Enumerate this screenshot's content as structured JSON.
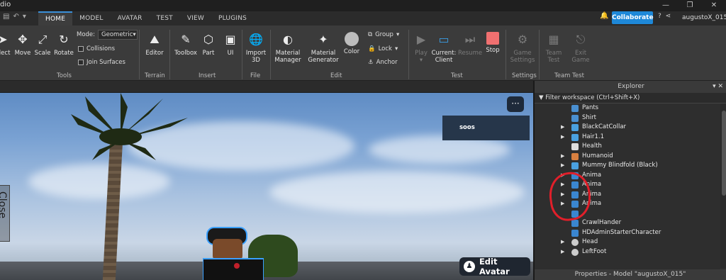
{
  "window": {
    "title": "dio",
    "controls": [
      "—",
      "❐",
      "✕"
    ]
  },
  "tabs": [
    "HOME",
    "MODEL",
    "AVATAR",
    "TEST",
    "VIEW",
    "PLUGINS"
  ],
  "topbar": {
    "collaborate_label": "Collaborate",
    "username": "augustoX_015"
  },
  "ribbon": {
    "tools": {
      "select": "elect",
      "move": "Move",
      "scale": "Scale",
      "rotate": "Rotate",
      "mode_label": "Mode:",
      "mode_value": "Geometric",
      "collisions": "Collisions",
      "join_surfaces": "Join Surfaces",
      "group_label": "Tools"
    },
    "terrain": {
      "editor": "Editor",
      "group_label": "Terrain"
    },
    "insert": {
      "toolbox": "Toolbox",
      "part": "Part",
      "ui": "UI",
      "group_label": "Insert"
    },
    "file": {
      "import_line1": "Import",
      "import_line2": "3D",
      "group_label": "File"
    },
    "edit": {
      "material_manager_1": "Material",
      "material_manager_2": "Manager",
      "material_generator_1": "Material",
      "material_generator_2": "Generator",
      "color": "Color",
      "group": "Group",
      "lock": "Lock",
      "anchor": "Anchor",
      "group_label": "Edit"
    },
    "test": {
      "play": "Play",
      "current_1": "Current:",
      "current_2": "Client",
      "resume": "Resume",
      "stop": "Stop",
      "group_label": "Test"
    },
    "settings": {
      "game_1": "Game",
      "game_2": "Settings",
      "group_label": "Settings"
    },
    "team_test": {
      "team_1": "Team",
      "team_2": "Test",
      "exit_1": "Exit",
      "exit_2": "Game",
      "group_label": "Team Test"
    }
  },
  "viewport": {
    "close_label": "Close",
    "dots": "···",
    "soos_label": "soos",
    "edit_avatar_label": "Edit Avatar"
  },
  "explorer": {
    "title": "Explorer",
    "filter_placeholder": "Filter workspace (Ctrl+Shift+X)",
    "items": [
      {
        "label": "Pants",
        "icon": "pants-icon",
        "arrow": false
      },
      {
        "label": "Shirt",
        "icon": "shirt-icon",
        "arrow": false
      },
      {
        "label": "BlackCatCollar",
        "icon": "accessory-icon",
        "arrow": true
      },
      {
        "label": "Hair1.1",
        "icon": "accessory-icon",
        "arrow": true
      },
      {
        "label": "Health",
        "icon": "script-icon",
        "arrow": false
      },
      {
        "label": "Humanoid",
        "icon": "humanoid-icon",
        "arrow": true
      },
      {
        "label": "Mummy Blindfold (Black)",
        "icon": "accessory-icon",
        "arrow": true
      },
      {
        "label": "Anima",
        "icon": "localscript-icon",
        "arrow": true
      },
      {
        "label": "Anima",
        "icon": "localscript-icon",
        "arrow": true
      },
      {
        "label": "Anima",
        "icon": "localscript-icon",
        "arrow": true
      },
      {
        "label": "Anima",
        "icon": "localscript-icon",
        "arrow": true
      },
      {
        "label": "",
        "icon": "localscript-icon",
        "arrow": false
      },
      {
        "label": "CrawlHander",
        "icon": "localscript-icon",
        "arrow": false
      },
      {
        "label": "HDAdminStarterCharacter",
        "icon": "localscript-icon",
        "arrow": false
      },
      {
        "label": "Head",
        "icon": "part-icon",
        "arrow": true
      },
      {
        "label": "LeftFoot",
        "icon": "part-icon",
        "arrow": true
      }
    ]
  },
  "properties": {
    "title": "Properties - Model \"augustoX_015\""
  },
  "colors": {
    "accent": "#1e88d8",
    "highlight_circle": "#e01f2a",
    "stop": "#f07070"
  }
}
